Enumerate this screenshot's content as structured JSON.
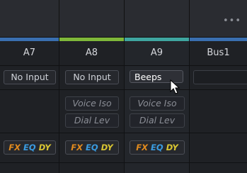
{
  "topbar": {
    "more_icon": "more-horizontal-icon"
  },
  "tracks": [
    {
      "name": "A7",
      "input": "No Input",
      "effects": [],
      "color": "#3a6fb0"
    },
    {
      "name": "A8",
      "input": "No Input",
      "effects": [
        "Voice Iso",
        "Dial Lev"
      ],
      "color": "#7fb83a"
    },
    {
      "name": "A9",
      "input": "Beeps",
      "effects": [
        "Voice Iso",
        "Dial Lev"
      ],
      "color": "#3fa6a0"
    },
    {
      "name": "Bus1",
      "input": "",
      "effects": [],
      "color": "#3a6fb0"
    }
  ],
  "fx_labels": {
    "fx": "FX",
    "eq": "EQ",
    "dy": "DY"
  },
  "colors": {
    "fx": "#e08a1e",
    "eq": "#3a9be0",
    "dy": "#d9c532"
  }
}
